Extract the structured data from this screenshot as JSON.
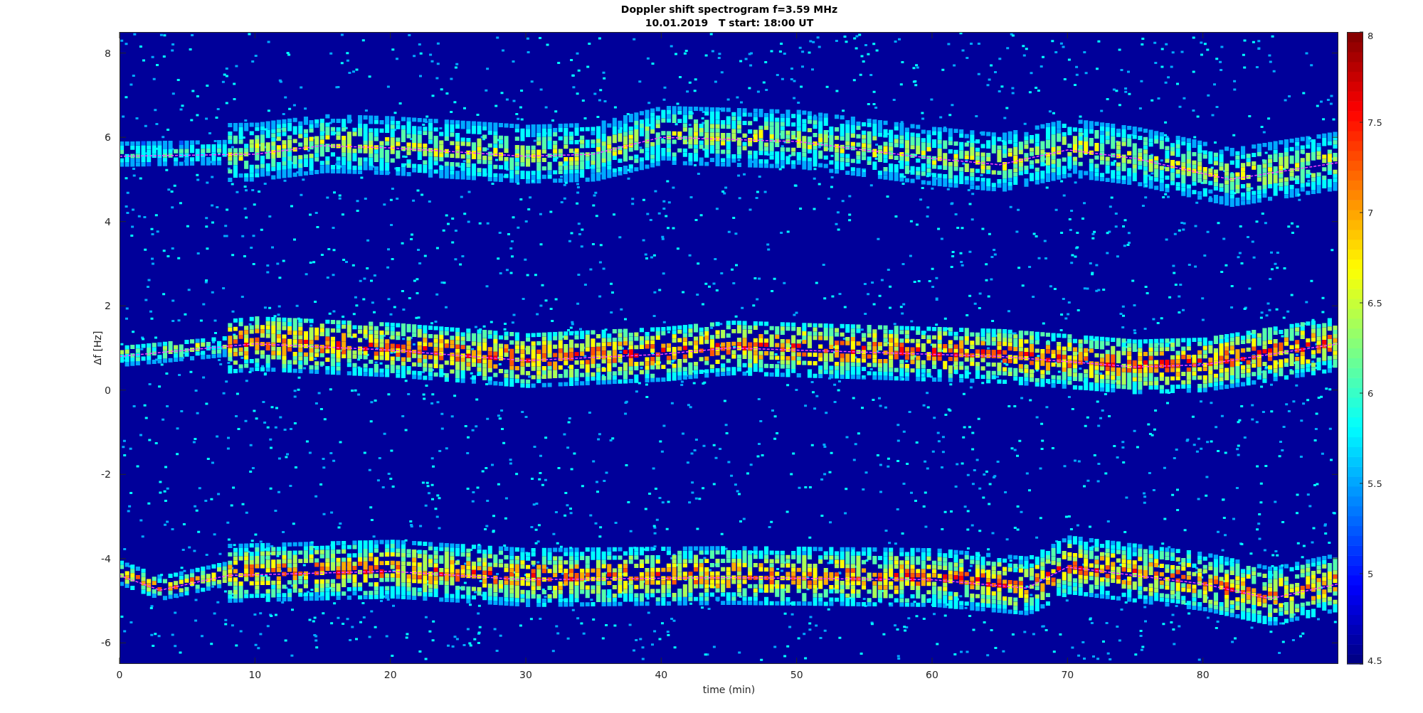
{
  "figure": {
    "title": "Doppler shift spectrogram f=3.59 MHz",
    "subtitle": "10.01.2019   T start: 18:00 UT",
    "xlabel": "time (min)",
    "ylabel": "Δf [Hz]",
    "xticks": [
      "0",
      "10",
      "20",
      "30",
      "40",
      "50",
      "60",
      "70",
      "80"
    ],
    "yticks": [
      "8",
      "6",
      "4",
      "2",
      "0",
      "-2",
      "-4",
      "-6"
    ],
    "colorbar": {
      "ticks": [
        "8",
        "7.5",
        "7",
        "6.5",
        "6",
        "5.5",
        "5",
        "4.5"
      ]
    }
  }
}
